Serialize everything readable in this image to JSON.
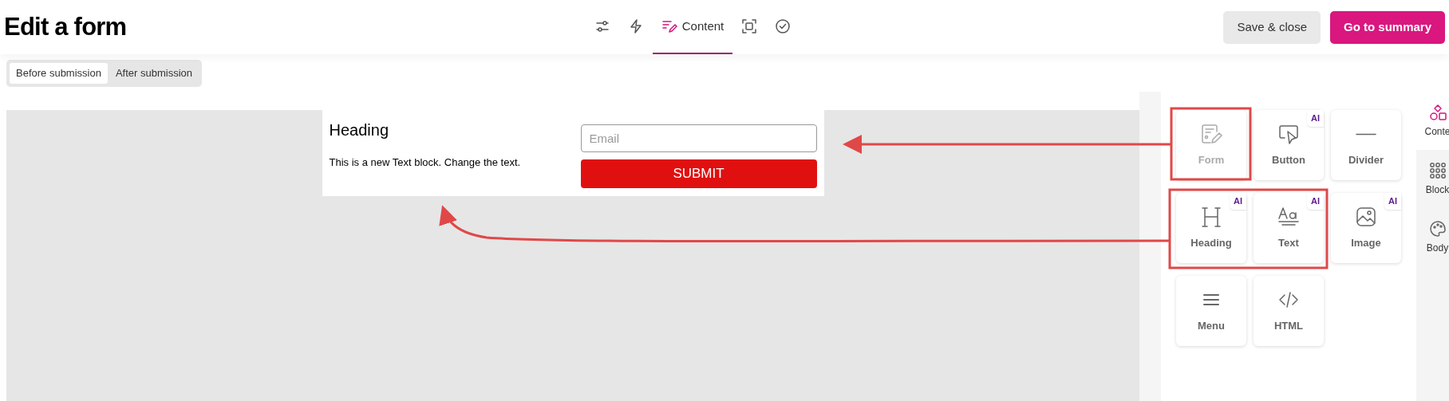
{
  "header": {
    "title": "Edit a form",
    "tabs": [
      {
        "selected": false
      },
      {
        "selected": false
      },
      {
        "label": "Content",
        "selected": true
      },
      {
        "selected": false
      },
      {
        "selected": false
      }
    ],
    "buttons": [
      {
        "label": "Save & close",
        "kind": "secondary"
      },
      {
        "label": "Go to summary",
        "kind": "primary"
      }
    ]
  },
  "view_toggle": [
    {
      "label": "Before submission",
      "selected": true
    },
    {
      "label": "After submission",
      "selected": false
    }
  ],
  "form_preview": {
    "heading": "Heading",
    "text": "This is a new Text block. Change the text.",
    "email_placeholder": "Email",
    "submit": "SUBMIT"
  },
  "blocks": [
    {
      "label": "Form",
      "disabled": true
    },
    {
      "label": "Button",
      "badge": "AI",
      "disabled": false
    },
    {
      "label": "Divider",
      "disabled": false
    },
    {
      "label": "Heading",
      "badge": "AI",
      "disabled": false
    },
    {
      "label": "Text",
      "badge": "AI",
      "disabled": false
    },
    {
      "label": "Image",
      "badge": "AI",
      "disabled": false
    },
    {
      "label": "Menu",
      "disabled": false
    },
    {
      "label": "HTML",
      "disabled": false
    }
  ],
  "side_tabs": [
    {
      "label": "Conte",
      "selected": true
    },
    {
      "label": "Block",
      "selected": false
    },
    {
      "label": "Body",
      "selected": false
    }
  ]
}
